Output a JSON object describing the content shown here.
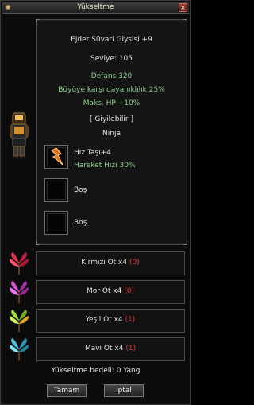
{
  "window": {
    "title": "Yükseltme"
  },
  "item": {
    "name": "Ejder Süvari Giysisi +9",
    "level": "Seviye: 105",
    "stats": [
      "Defans 320",
      "Büyüye karşı dayanıklılık 25%",
      "Maks. HP +10%"
    ],
    "wearable_header": "[ Giyilebilir ]",
    "wearable_class": "Ninja"
  },
  "sockets": [
    {
      "line1": "Hız Taşı+4",
      "line2": "Hareket Hızı 30%",
      "icon": "speed-stone-icon"
    },
    {
      "line1": "Boş"
    },
    {
      "line1": "Boş"
    }
  ],
  "herbs": [
    {
      "label": "Kırmızı Ot x4",
      "count": "(0)",
      "icon": "red-herb-icon",
      "color": "#e0354a"
    },
    {
      "label": "Mor Ot x4",
      "count": "(0)",
      "icon": "purple-herb-icon",
      "color": "#c040c0"
    },
    {
      "label": "Yeşil Ot x4",
      "count": "(1)",
      "icon": "green-herb-icon",
      "color": "#90d030"
    },
    {
      "label": "Mavi Ot x4",
      "count": "(1)",
      "icon": "blue-herb-icon",
      "color": "#40b0d0"
    }
  ],
  "cost": "Yükseltme bedeli: 0 Yang",
  "buttons": {
    "ok": "Tamam",
    "cancel": "iptal"
  },
  "colors": {
    "stat_green": "#8fd18f",
    "missing_red": "#e23a3a"
  }
}
